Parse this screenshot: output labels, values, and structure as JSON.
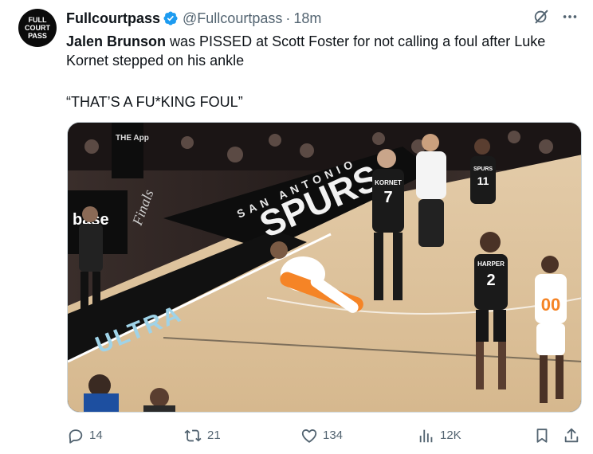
{
  "tweet": {
    "avatar_text": [
      "FULL",
      "COURT",
      "PASS"
    ],
    "display_name": "Fullcourtpass",
    "handle": "@Fullcourtpass",
    "separator": "·",
    "time": "18m",
    "text_bold": "Jalen Brunson",
    "text_rest": " was PISSED at Scott Foster for not calling a foul after Luke Kornet stepped on his ankle",
    "quote": "“THAT’S A FU*KING FOUL”"
  },
  "media": {
    "court_text": [
      "SAN ANTONIO",
      "SPURS",
      "ULTRA",
      "Finals",
      "THE App",
      "base"
    ],
    "jerseys": [
      {
        "team": "KORNET",
        "number": "7"
      },
      {
        "team": "HARPER",
        "number": "2"
      },
      {
        "team": "",
        "number": "00"
      },
      {
        "team": "SPURS",
        "number": "11"
      }
    ]
  },
  "actions": {
    "replies": "14",
    "reposts": "21",
    "likes": "134",
    "views": "12K"
  },
  "colors": {
    "verified": "#1d9bf0",
    "secondary_text": "#536471",
    "knicks_orange": "#f58426",
    "spurs_black": "#1a1a1a"
  },
  "icons": [
    "verified-badge-icon",
    "grok-icon",
    "more-icon",
    "reply-icon",
    "repost-icon",
    "like-icon",
    "views-icon",
    "bookmark-icon",
    "share-icon"
  ]
}
